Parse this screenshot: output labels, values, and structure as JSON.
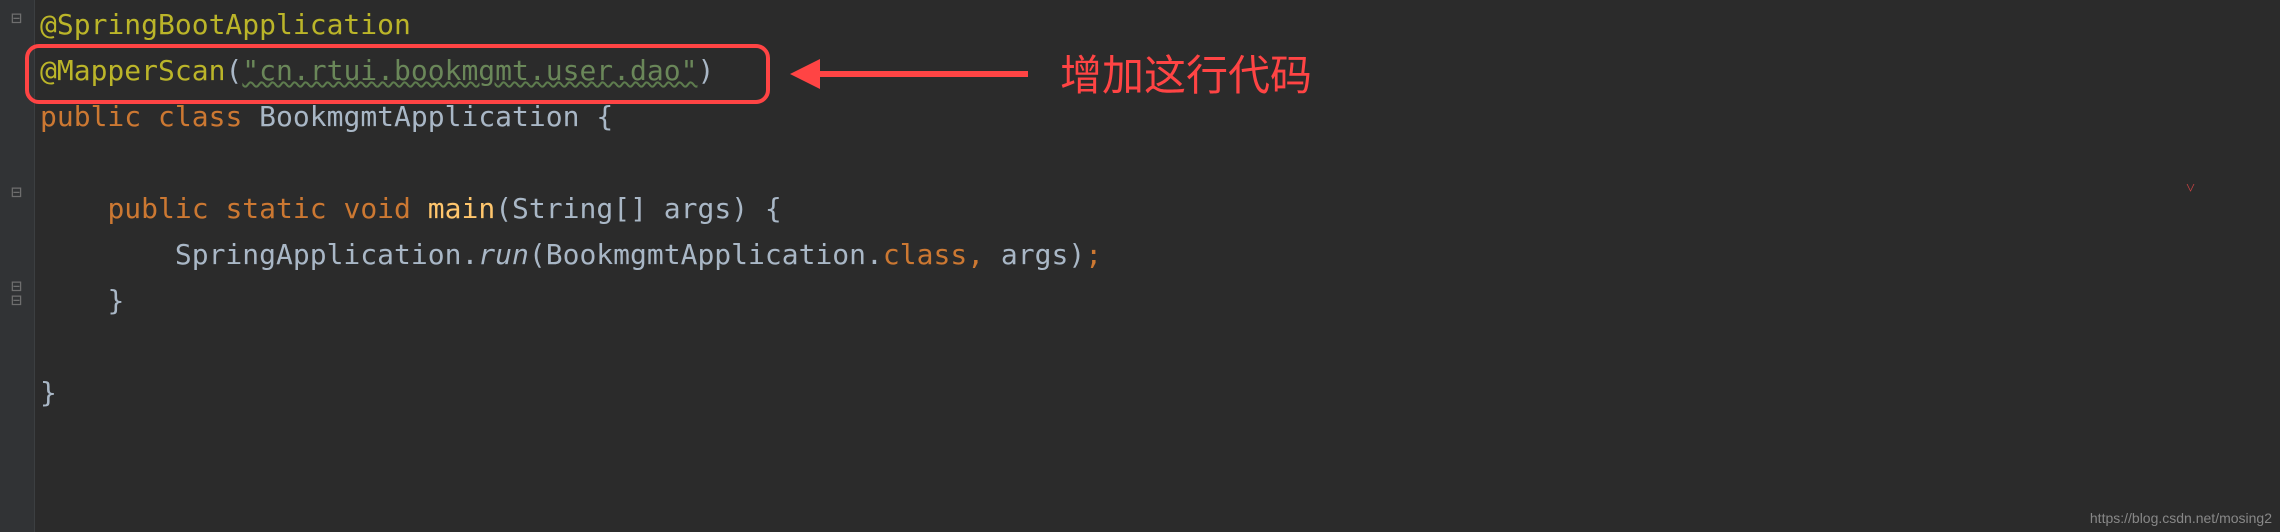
{
  "code": {
    "line1": {
      "annotation": "@SpringBootApplication"
    },
    "line2": {
      "annotation": "@MapperScan",
      "paren_open": "(",
      "string": "\"cn.rtui.bookmgmt.user.dao\"",
      "paren_close": ")"
    },
    "line3": {
      "keyword1": "public ",
      "keyword2": "class ",
      "classname": "BookmgmtApplication",
      "brace": " {"
    },
    "line4": "",
    "line5": {
      "indent": "    ",
      "keyword1": "public ",
      "keyword2": "static ",
      "keyword3": "void ",
      "method": "main",
      "params": "(String[] args) {"
    },
    "line6": {
      "indent": "        ",
      "classname": "SpringApplication",
      "dot": ".",
      "method": "run",
      "paren": "(BookmgmtApplication",
      "dot2": ".",
      "keyword": "class",
      "comma": ", ",
      "args": "args)",
      "semi": ";"
    },
    "line7": {
      "indent": "    ",
      "brace": "}"
    },
    "line8": "",
    "line9": {
      "brace": "}"
    }
  },
  "callout": {
    "text": "增加这行代码"
  },
  "watermark": "https://blog.csdn.net/mosing2"
}
